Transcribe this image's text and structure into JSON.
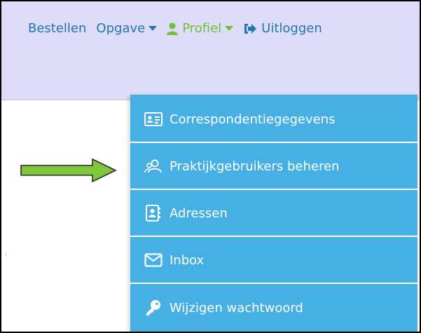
{
  "nav": {
    "bestellen": "Bestellen",
    "opgave": "Opgave",
    "profiel": "Profiel",
    "uitloggen": "Uitloggen"
  },
  "menu": {
    "items": [
      {
        "label": "Correspondentiegegevens",
        "icon": "contact-card-icon"
      },
      {
        "label": "Praktijkgebruikers beheren",
        "icon": "users-icon"
      },
      {
        "label": "Adressen",
        "icon": "address-book-icon"
      },
      {
        "label": "Inbox",
        "icon": "envelope-icon"
      },
      {
        "label": "Wijzigen wachtwoord",
        "icon": "key-icon"
      }
    ]
  },
  "colors": {
    "navbar_bg": "#dedcf8",
    "nav_link": "#2277b3",
    "profile_link": "#6cc33a",
    "dropdown_bg": "#46b0e4",
    "arrow_fill": "#80c63a"
  }
}
